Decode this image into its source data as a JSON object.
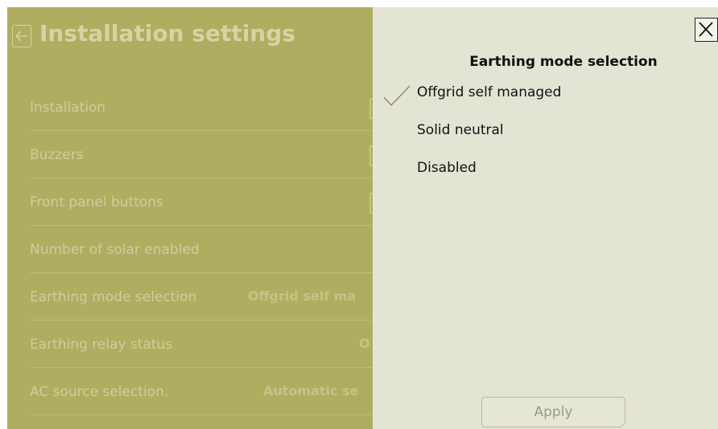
{
  "settings_page": {
    "title": "Installation settings",
    "rows": [
      {
        "label": "Installation",
        "value": ""
      },
      {
        "label": "Buzzers",
        "value": ""
      },
      {
        "label": "Front panel buttons",
        "value": ""
      },
      {
        "label": "Number of solar enabled",
        "value": ""
      },
      {
        "label": "Earthing mode selection",
        "value": "Offgrid self ma"
      },
      {
        "label": "Earthing relay status",
        "value": "O"
      },
      {
        "label": "AC source selection.",
        "value": "Automatic se"
      }
    ]
  },
  "selection_panel": {
    "title": "Earthing mode selection",
    "options": [
      {
        "label": "Offgrid self managed",
        "selected": true
      },
      {
        "label": "Solid neutral",
        "selected": false
      },
      {
        "label": "Disabled",
        "selected": false
      }
    ],
    "apply_label": "Apply"
  },
  "colors": {
    "dimmed_background": "#afae60",
    "panel_background": "#e4e4d5",
    "check_color": "#8a8a70"
  },
  "icons": {
    "back": "back-arrow-icon",
    "close": "close-icon",
    "check": "checkmark-icon"
  }
}
